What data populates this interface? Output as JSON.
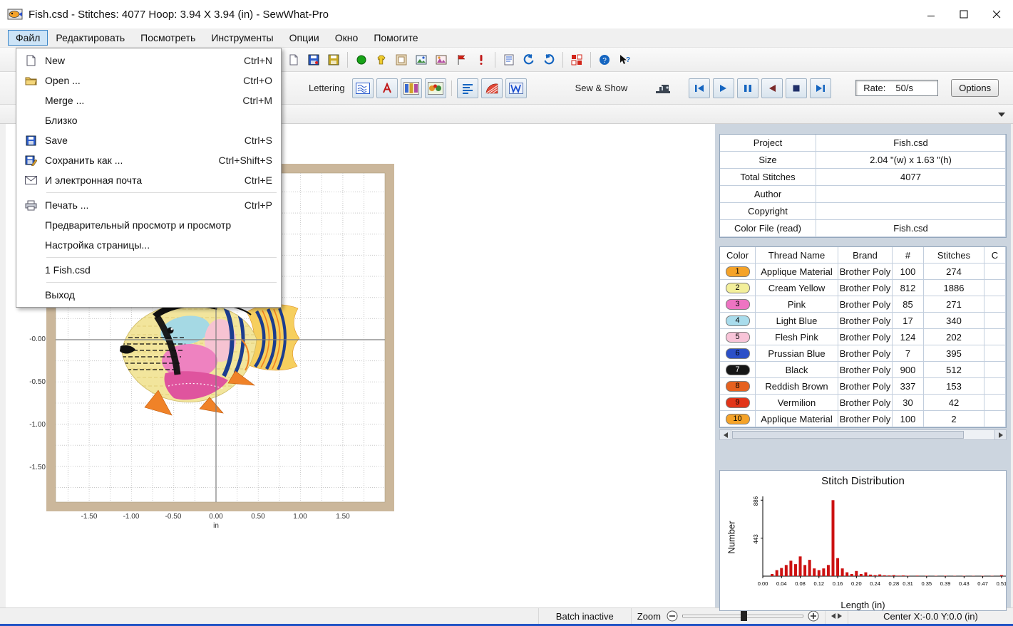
{
  "titlebar": {
    "title": "Fish.csd - Stitches: 4077  Hoop: 3.94 X 3.94 (in) - SewWhat-Pro"
  },
  "menubar": {
    "items": [
      {
        "label": "Файл"
      },
      {
        "label": "Редактировать"
      },
      {
        "label": "Посмотреть"
      },
      {
        "label": "Инструменты"
      },
      {
        "label": "Опции"
      },
      {
        "label": "Окно"
      },
      {
        "label": "Помогите"
      }
    ]
  },
  "file_menu": {
    "items": [
      {
        "label": "New",
        "shortcut": "Ctrl+N"
      },
      {
        "label": "Open ...",
        "shortcut": "Ctrl+O"
      },
      {
        "label": "Merge ...",
        "shortcut": "Ctrl+M"
      },
      {
        "label": "Близко",
        "shortcut": ""
      },
      {
        "label": "Save",
        "shortcut": "Ctrl+S"
      },
      {
        "label": "Сохранить  как ...",
        "shortcut": "Ctrl+Shift+S"
      },
      {
        "label": "И электронная почта",
        "shortcut": "Ctrl+E"
      },
      {
        "label": "Печать ...",
        "shortcut": "Ctrl+P"
      },
      {
        "label": "Предварительный просмотр и просмотр",
        "shortcut": ""
      },
      {
        "label": "Настройка страницы...",
        "shortcut": ""
      },
      {
        "label": "1 Fish.csd",
        "shortcut": ""
      },
      {
        "label": "Выход",
        "shortcut": ""
      }
    ]
  },
  "toolbar2": {
    "lettering": "Lettering",
    "sew_show": "Sew & Show",
    "rate_label": "Rate:",
    "rate_value": "50/s",
    "options": "Options"
  },
  "canvas": {
    "v_labels": [
      "-0.00",
      "-0.50",
      "-1.00",
      "-1.50"
    ],
    "h_labels": [
      "-1.50",
      "-1.00",
      "-0.50",
      "0.00",
      "0.50",
      "1.00",
      "1.50"
    ],
    "unit": "in"
  },
  "info_table": {
    "rows": [
      {
        "label": "Project",
        "value": "Fish.csd"
      },
      {
        "label": "Size",
        "value": "2.04 \"(w) x 1.63 \"(h)"
      },
      {
        "label": "Total Stitches",
        "value": "4077"
      },
      {
        "label": "Author",
        "value": ""
      },
      {
        "label": "Copyright",
        "value": ""
      },
      {
        "label": "Color File (read)",
        "value": "Fish.csd"
      }
    ]
  },
  "color_table": {
    "headers": [
      "Color",
      "Thread Name",
      "Brand",
      "#",
      "Stitches",
      "C"
    ],
    "rows": [
      {
        "num": "1",
        "swatch": "#f5a329",
        "swatch_text": "#000000",
        "thread": "Applique Material",
        "brand": "Brother Poly",
        "code": "100",
        "stitches": "274"
      },
      {
        "num": "2",
        "swatch": "#f3ef9b",
        "swatch_text": "#000000",
        "thread": "Cream Yellow",
        "brand": "Brother Poly",
        "code": "812",
        "stitches": "1886"
      },
      {
        "num": "3",
        "swatch": "#ee74c2",
        "swatch_text": "#000000",
        "thread": "Pink",
        "brand": "Brother Poly",
        "code": "85",
        "stitches": "271"
      },
      {
        "num": "4",
        "swatch": "#a9dcec",
        "swatch_text": "#000000",
        "thread": "Light Blue",
        "brand": "Brother Poly",
        "code": "17",
        "stitches": "340"
      },
      {
        "num": "5",
        "swatch": "#f8c4d8",
        "swatch_text": "#000000",
        "thread": "Flesh Pink",
        "brand": "Brother Poly",
        "code": "124",
        "stitches": "202"
      },
      {
        "num": "6",
        "swatch": "#2b4fc8",
        "swatch_text": "#000000",
        "thread": "Prussian Blue",
        "brand": "Brother Poly",
        "code": "7",
        "stitches": "395"
      },
      {
        "num": "7",
        "swatch": "#161616",
        "swatch_text": "#ffffff",
        "thread": "Black",
        "brand": "Brother Poly",
        "code": "900",
        "stitches": "512"
      },
      {
        "num": "8",
        "swatch": "#e6611f",
        "swatch_text": "#000000",
        "thread": "Reddish Brown",
        "brand": "Brother Poly",
        "code": "337",
        "stitches": "153"
      },
      {
        "num": "9",
        "swatch": "#e23418",
        "swatch_text": "#000000",
        "thread": "Vermilion",
        "brand": "Brother Poly",
        "code": "30",
        "stitches": "42"
      },
      {
        "num": "10",
        "swatch": "#f5a329",
        "swatch_text": "#000000",
        "thread": "Applique Material",
        "brand": "Brother Poly",
        "code": "100",
        "stitches": "2"
      }
    ]
  },
  "statusbar": {
    "batch": "Batch inactive",
    "zoom_label": "Zoom",
    "center": "Center X:-0.0  Y:0.0 (in)"
  },
  "chart_data": {
    "type": "bar",
    "title": "Stitch Distribution",
    "xlabel": "Length (in)",
    "ylabel": "Number",
    "x_tick_labels": [
      "0.00",
      "0.04",
      "0.08",
      "0.12",
      "0.16",
      "0.20",
      "0.24",
      "0.28",
      "0.31",
      "0.35",
      "0.39",
      "0.43",
      "0.47",
      "0.51"
    ],
    "y_ticks": [
      443,
      886
    ],
    "xlim": [
      0,
      0.53
    ],
    "ylim": [
      0,
      930
    ],
    "bar_color": "#cc1111",
    "grid": false,
    "legend": false,
    "x": [
      0.02,
      0.03,
      0.04,
      0.05,
      0.06,
      0.07,
      0.08,
      0.09,
      0.1,
      0.11,
      0.12,
      0.13,
      0.14,
      0.15,
      0.16,
      0.17,
      0.18,
      0.19,
      0.2,
      0.21,
      0.22,
      0.23,
      0.24,
      0.25,
      0.26,
      0.27,
      0.28,
      0.29,
      0.3,
      0.31,
      0.33,
      0.35,
      0.37,
      0.39,
      0.41,
      0.43,
      0.45,
      0.47,
      0.49,
      0.51
    ],
    "values": [
      25,
      70,
      95,
      130,
      180,
      140,
      230,
      130,
      190,
      90,
      70,
      90,
      130,
      886,
      210,
      90,
      45,
      25,
      60,
      25,
      45,
      18,
      12,
      20,
      10,
      8,
      12,
      6,
      8,
      5,
      6,
      5,
      4,
      5,
      3,
      4,
      3,
      4,
      3,
      12
    ]
  }
}
